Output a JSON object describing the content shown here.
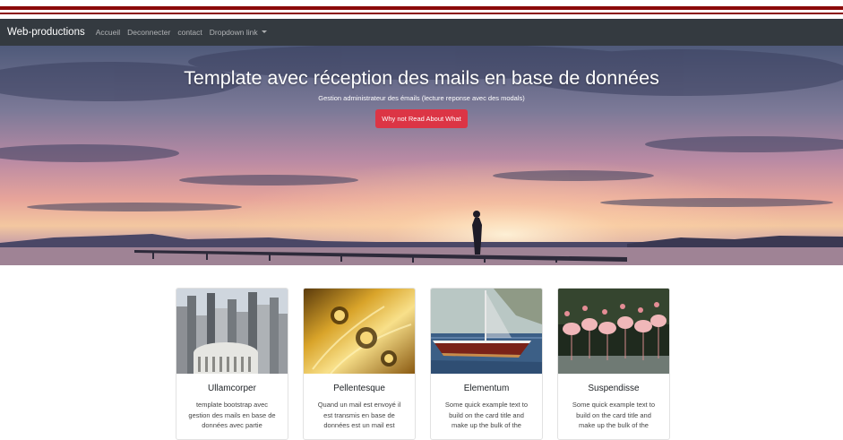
{
  "navbar": {
    "brand": "Web-productions",
    "links": [
      "Accueil",
      "Deconnecter",
      "contact",
      "Dropdown link"
    ]
  },
  "hero": {
    "title": "Template avec réception des mails en base de données",
    "subtitle": "Gestion administrateur des émails (lecture reponse avec des modals)",
    "button": "Why not Read About What"
  },
  "cards": [
    {
      "title": "Ullamcorper",
      "text": "template bootstrap avec gestion des mails en base de données avec partie",
      "image": "city-skyline"
    },
    {
      "title": "Pellentesque",
      "text": "Quand un mail est envoyé il est transmis en base de données est un mail est",
      "image": "saxophone"
    },
    {
      "title": "Elementum",
      "text": "Some quick example text to build on the card title and make up the bulk of the",
      "image": "sailboat"
    },
    {
      "title": "Suspendisse",
      "text": "Some quick example text to build on the card title and make up the bulk of the",
      "image": "flamingos"
    }
  ],
  "colors": {
    "accent_strip": "#8b0a0a",
    "navbar_bg": "#343a40",
    "button_bg": "#dc3545"
  }
}
